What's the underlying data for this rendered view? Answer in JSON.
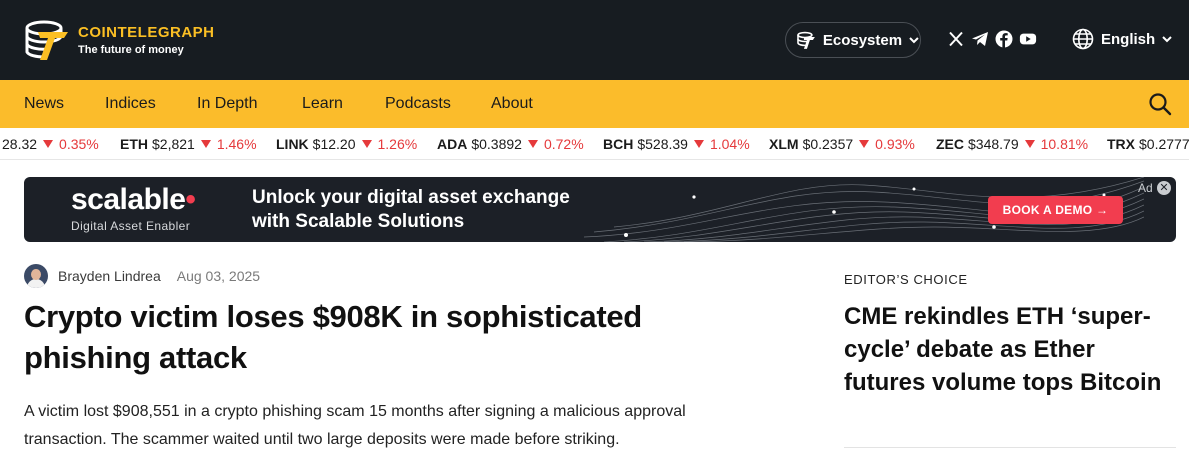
{
  "header": {
    "brand_name": "COINTELEGRAPH",
    "tagline": "The future of money",
    "ecosystem_label": "Ecosystem",
    "language_label": "English",
    "social_icons": [
      "x-icon",
      "telegram-icon",
      "facebook-icon",
      "youtube-icon"
    ],
    "colors": {
      "background": "#171c21",
      "brand": "#fbbf24"
    }
  },
  "nav": {
    "items": [
      "News",
      "Indices",
      "In Depth",
      "Learn",
      "Podcasts",
      "About"
    ],
    "background": "#fbbc2b"
  },
  "ticker": {
    "items": [
      {
        "symbol": "",
        "price": "28.32",
        "change": "0.35%"
      },
      {
        "symbol": "ETH",
        "price": "$2,821",
        "change": "1.46%"
      },
      {
        "symbol": "LINK",
        "price": "$12.20",
        "change": "1.26%"
      },
      {
        "symbol": "ADA",
        "price": "$0.3892",
        "change": "0.72%"
      },
      {
        "symbol": "BCH",
        "price": "$528.39",
        "change": "1.04%"
      },
      {
        "symbol": "XLM",
        "price": "$0.2357",
        "change": "0.93%"
      },
      {
        "symbol": "ZEC",
        "price": "$348.79",
        "change": "10.81%"
      },
      {
        "symbol": "TRX",
        "price": "$0.2777",
        "change": ""
      }
    ],
    "negative_color": "#e5393b"
  },
  "ad": {
    "brand": "scalable",
    "brand_dot": "•",
    "subtitle": "Digital Asset Enabler",
    "headline": "Unlock your digital asset exchange with Scalable Solutions",
    "cta": "BOOK A DEMO →",
    "label": "Ad",
    "close": "✕",
    "cta_color": "#f23d4f"
  },
  "article": {
    "author": "Brayden Lindrea",
    "date": "Aug 03, 2025",
    "title": "Crypto victim loses $908K in sophisticated phishing attack",
    "lead": "A victim lost $908,551 in a crypto phishing scam 15 months after signing a malicious approval transaction. The scammer waited until two large deposits were made before striking."
  },
  "sidebar": {
    "section_label": "EDITOR’S CHOICE",
    "title": "CME rekindles ETH ‘super-cycle’ debate as Ether futures volume tops Bitcoin"
  }
}
